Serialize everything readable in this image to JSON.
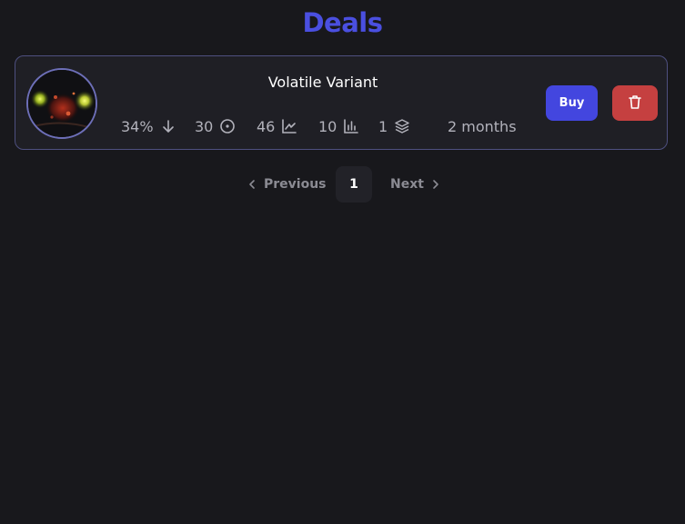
{
  "page": {
    "title": "Deals"
  },
  "deals": [
    {
      "name": "Volatile Variant",
      "stats": {
        "percent": "34%",
        "percent_icon": "arrow-down-icon",
        "count_a": "30",
        "count_a_icon": "circle-dot-icon",
        "count_b": "46",
        "count_b_icon": "line-chart-icon",
        "count_c": "10",
        "count_c_icon": "bar-chart-icon",
        "count_d": "1",
        "count_d_icon": "layers-icon",
        "age": "2 months"
      },
      "buy_label": "Buy",
      "delete_icon": "trash-icon"
    }
  ],
  "pagination": {
    "previous_label": "Previous",
    "current_page": "1",
    "next_label": "Next"
  },
  "colors": {
    "background": "#18181c",
    "accent": "#4346df",
    "title": "#4a4fe0",
    "danger": "#c54040",
    "card_border": "#4e5080"
  }
}
